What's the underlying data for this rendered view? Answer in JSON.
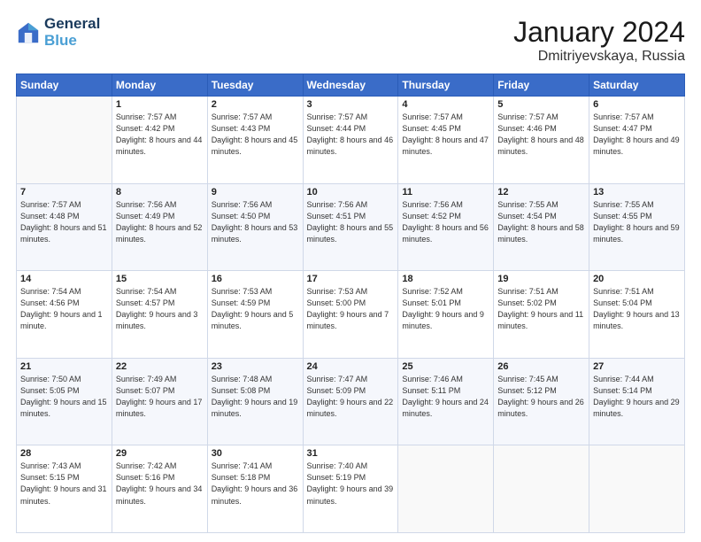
{
  "header": {
    "logo_line1": "General",
    "logo_line2": "Blue",
    "month": "January 2024",
    "location": "Dmitriyevskaya, Russia"
  },
  "weekdays": [
    "Sunday",
    "Monday",
    "Tuesday",
    "Wednesday",
    "Thursday",
    "Friday",
    "Saturday"
  ],
  "weeks": [
    [
      {
        "day": "",
        "sunrise": "",
        "sunset": "",
        "daylight": ""
      },
      {
        "day": "1",
        "sunrise": "Sunrise: 7:57 AM",
        "sunset": "Sunset: 4:42 PM",
        "daylight": "Daylight: 8 hours and 44 minutes."
      },
      {
        "day": "2",
        "sunrise": "Sunrise: 7:57 AM",
        "sunset": "Sunset: 4:43 PM",
        "daylight": "Daylight: 8 hours and 45 minutes."
      },
      {
        "day": "3",
        "sunrise": "Sunrise: 7:57 AM",
        "sunset": "Sunset: 4:44 PM",
        "daylight": "Daylight: 8 hours and 46 minutes."
      },
      {
        "day": "4",
        "sunrise": "Sunrise: 7:57 AM",
        "sunset": "Sunset: 4:45 PM",
        "daylight": "Daylight: 8 hours and 47 minutes."
      },
      {
        "day": "5",
        "sunrise": "Sunrise: 7:57 AM",
        "sunset": "Sunset: 4:46 PM",
        "daylight": "Daylight: 8 hours and 48 minutes."
      },
      {
        "day": "6",
        "sunrise": "Sunrise: 7:57 AM",
        "sunset": "Sunset: 4:47 PM",
        "daylight": "Daylight: 8 hours and 49 minutes."
      }
    ],
    [
      {
        "day": "7",
        "sunrise": "Sunrise: 7:57 AM",
        "sunset": "Sunset: 4:48 PM",
        "daylight": "Daylight: 8 hours and 51 minutes."
      },
      {
        "day": "8",
        "sunrise": "Sunrise: 7:56 AM",
        "sunset": "Sunset: 4:49 PM",
        "daylight": "Daylight: 8 hours and 52 minutes."
      },
      {
        "day": "9",
        "sunrise": "Sunrise: 7:56 AM",
        "sunset": "Sunset: 4:50 PM",
        "daylight": "Daylight: 8 hours and 53 minutes."
      },
      {
        "day": "10",
        "sunrise": "Sunrise: 7:56 AM",
        "sunset": "Sunset: 4:51 PM",
        "daylight": "Daylight: 8 hours and 55 minutes."
      },
      {
        "day": "11",
        "sunrise": "Sunrise: 7:56 AM",
        "sunset": "Sunset: 4:52 PM",
        "daylight": "Daylight: 8 hours and 56 minutes."
      },
      {
        "day": "12",
        "sunrise": "Sunrise: 7:55 AM",
        "sunset": "Sunset: 4:54 PM",
        "daylight": "Daylight: 8 hours and 58 minutes."
      },
      {
        "day": "13",
        "sunrise": "Sunrise: 7:55 AM",
        "sunset": "Sunset: 4:55 PM",
        "daylight": "Daylight: 8 hours and 59 minutes."
      }
    ],
    [
      {
        "day": "14",
        "sunrise": "Sunrise: 7:54 AM",
        "sunset": "Sunset: 4:56 PM",
        "daylight": "Daylight: 9 hours and 1 minute."
      },
      {
        "day": "15",
        "sunrise": "Sunrise: 7:54 AM",
        "sunset": "Sunset: 4:57 PM",
        "daylight": "Daylight: 9 hours and 3 minutes."
      },
      {
        "day": "16",
        "sunrise": "Sunrise: 7:53 AM",
        "sunset": "Sunset: 4:59 PM",
        "daylight": "Daylight: 9 hours and 5 minutes."
      },
      {
        "day": "17",
        "sunrise": "Sunrise: 7:53 AM",
        "sunset": "Sunset: 5:00 PM",
        "daylight": "Daylight: 9 hours and 7 minutes."
      },
      {
        "day": "18",
        "sunrise": "Sunrise: 7:52 AM",
        "sunset": "Sunset: 5:01 PM",
        "daylight": "Daylight: 9 hours and 9 minutes."
      },
      {
        "day": "19",
        "sunrise": "Sunrise: 7:51 AM",
        "sunset": "Sunset: 5:02 PM",
        "daylight": "Daylight: 9 hours and 11 minutes."
      },
      {
        "day": "20",
        "sunrise": "Sunrise: 7:51 AM",
        "sunset": "Sunset: 5:04 PM",
        "daylight": "Daylight: 9 hours and 13 minutes."
      }
    ],
    [
      {
        "day": "21",
        "sunrise": "Sunrise: 7:50 AM",
        "sunset": "Sunset: 5:05 PM",
        "daylight": "Daylight: 9 hours and 15 minutes."
      },
      {
        "day": "22",
        "sunrise": "Sunrise: 7:49 AM",
        "sunset": "Sunset: 5:07 PM",
        "daylight": "Daylight: 9 hours and 17 minutes."
      },
      {
        "day": "23",
        "sunrise": "Sunrise: 7:48 AM",
        "sunset": "Sunset: 5:08 PM",
        "daylight": "Daylight: 9 hours and 19 minutes."
      },
      {
        "day": "24",
        "sunrise": "Sunrise: 7:47 AM",
        "sunset": "Sunset: 5:09 PM",
        "daylight": "Daylight: 9 hours and 22 minutes."
      },
      {
        "day": "25",
        "sunrise": "Sunrise: 7:46 AM",
        "sunset": "Sunset: 5:11 PM",
        "daylight": "Daylight: 9 hours and 24 minutes."
      },
      {
        "day": "26",
        "sunrise": "Sunrise: 7:45 AM",
        "sunset": "Sunset: 5:12 PM",
        "daylight": "Daylight: 9 hours and 26 minutes."
      },
      {
        "day": "27",
        "sunrise": "Sunrise: 7:44 AM",
        "sunset": "Sunset: 5:14 PM",
        "daylight": "Daylight: 9 hours and 29 minutes."
      }
    ],
    [
      {
        "day": "28",
        "sunrise": "Sunrise: 7:43 AM",
        "sunset": "Sunset: 5:15 PM",
        "daylight": "Daylight: 9 hours and 31 minutes."
      },
      {
        "day": "29",
        "sunrise": "Sunrise: 7:42 AM",
        "sunset": "Sunset: 5:16 PM",
        "daylight": "Daylight: 9 hours and 34 minutes."
      },
      {
        "day": "30",
        "sunrise": "Sunrise: 7:41 AM",
        "sunset": "Sunset: 5:18 PM",
        "daylight": "Daylight: 9 hours and 36 minutes."
      },
      {
        "day": "31",
        "sunrise": "Sunrise: 7:40 AM",
        "sunset": "Sunset: 5:19 PM",
        "daylight": "Daylight: 9 hours and 39 minutes."
      },
      {
        "day": "",
        "sunrise": "",
        "sunset": "",
        "daylight": ""
      },
      {
        "day": "",
        "sunrise": "",
        "sunset": "",
        "daylight": ""
      },
      {
        "day": "",
        "sunrise": "",
        "sunset": "",
        "daylight": ""
      }
    ]
  ]
}
